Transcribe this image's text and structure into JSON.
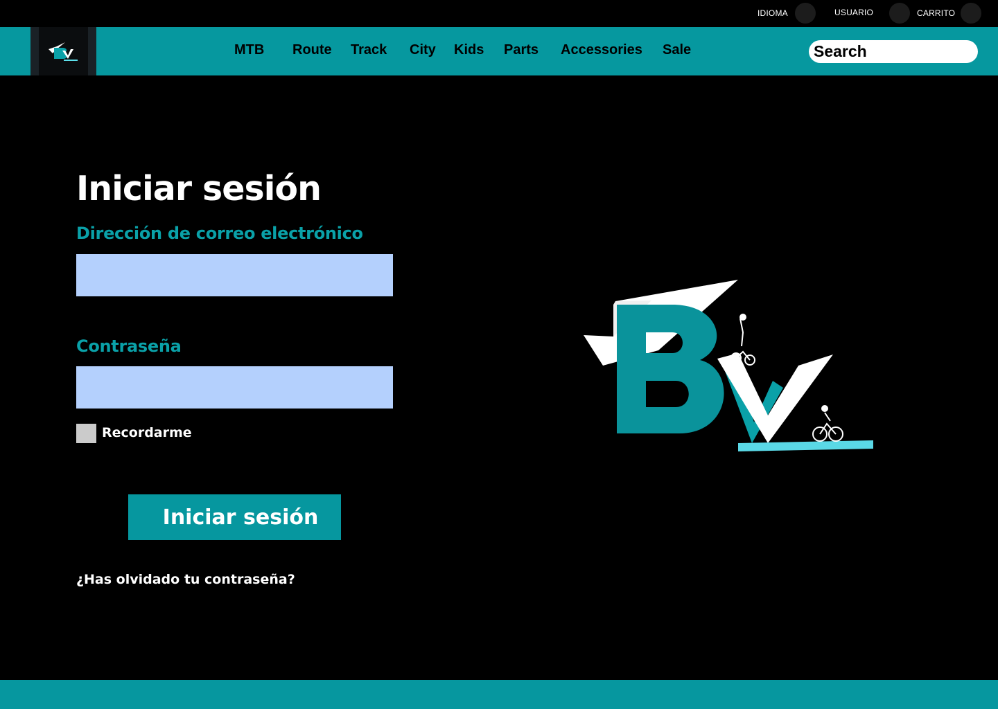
{
  "utility_bar": {
    "language_label": "IDIOMA",
    "user_label": "USUARIO",
    "cart_label": "CARRITO"
  },
  "nav": {
    "items": [
      "MTB",
      "Route",
      "Track",
      "City",
      "Kids",
      "Parts",
      "Accessories",
      "Sale"
    ],
    "search_placeholder": "Search"
  },
  "login": {
    "title": "Iniciar sesión",
    "email_label": "Dirección de correo electrónico",
    "email_value": "",
    "password_label": "Contraseña",
    "password_value": "",
    "remember_label": "Recordarme",
    "remember_checked": false,
    "submit_label": "Iniciar sesión",
    "forgot_label": "¿Has olvidado tu contraseña?"
  },
  "hero_logo": {
    "lettering": "BV"
  },
  "colors": {
    "brand_teal": "#06989f",
    "label_teal": "#0aa1a8",
    "input_bg": "#b4d0fd",
    "background": "#000000"
  }
}
